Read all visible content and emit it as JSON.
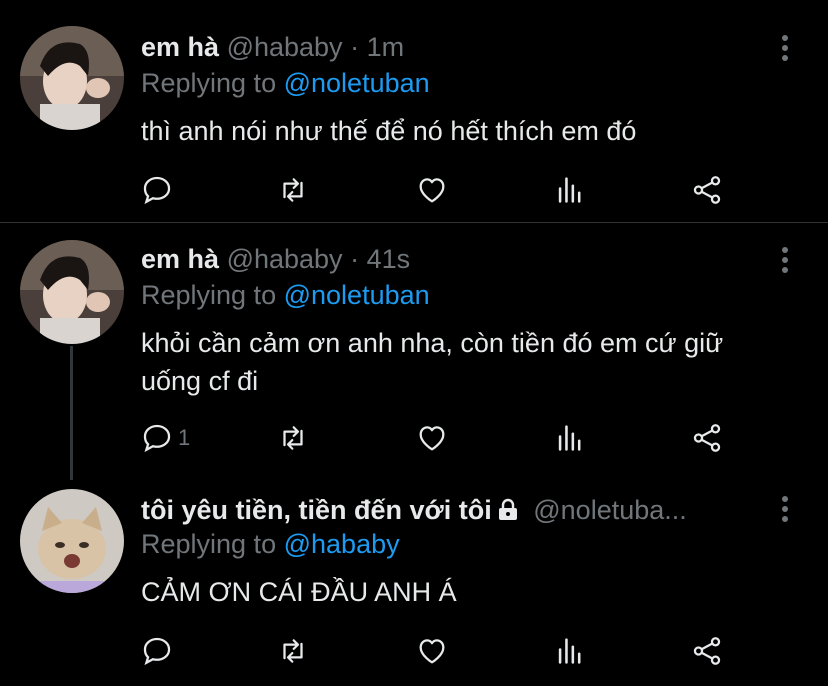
{
  "tweets": [
    {
      "name": "em hà",
      "handle": "@hababy",
      "dot": "·",
      "time": "1m",
      "reply_prefix": "Replying to",
      "reply_to": "@noletuban",
      "text": "thì anh nói như thế để nó hết thích em đó",
      "reply_count": ""
    },
    {
      "name": "em hà",
      "handle": "@hababy",
      "dot": "·",
      "time": "41s",
      "reply_prefix": "Replying to",
      "reply_to": "@noletuban",
      "text": "khỏi cần cảm ơn anh nha, còn tiền đó em cứ giữ uống cf đi",
      "reply_count": "1"
    },
    {
      "name": "tôi yêu tiền, tiền đến với tôi",
      "handle": "@noletuba...",
      "reply_prefix": "Replying to",
      "reply_to": "@hababy",
      "text": "CẢM ƠN CÁI ĐẦU ANH Á",
      "reply_count": ""
    }
  ],
  "icons": {
    "reply": "reply-icon",
    "retweet": "retweet-icon",
    "like": "like-icon",
    "analytics": "analytics-icon",
    "share": "share-icon",
    "more": "more-icon",
    "lock": "lock-icon"
  },
  "colors": {
    "background": "#000000",
    "text": "#e7e9ea",
    "muted": "#71767b",
    "mention": "#1d9bf0",
    "divider": "#2f3336"
  }
}
